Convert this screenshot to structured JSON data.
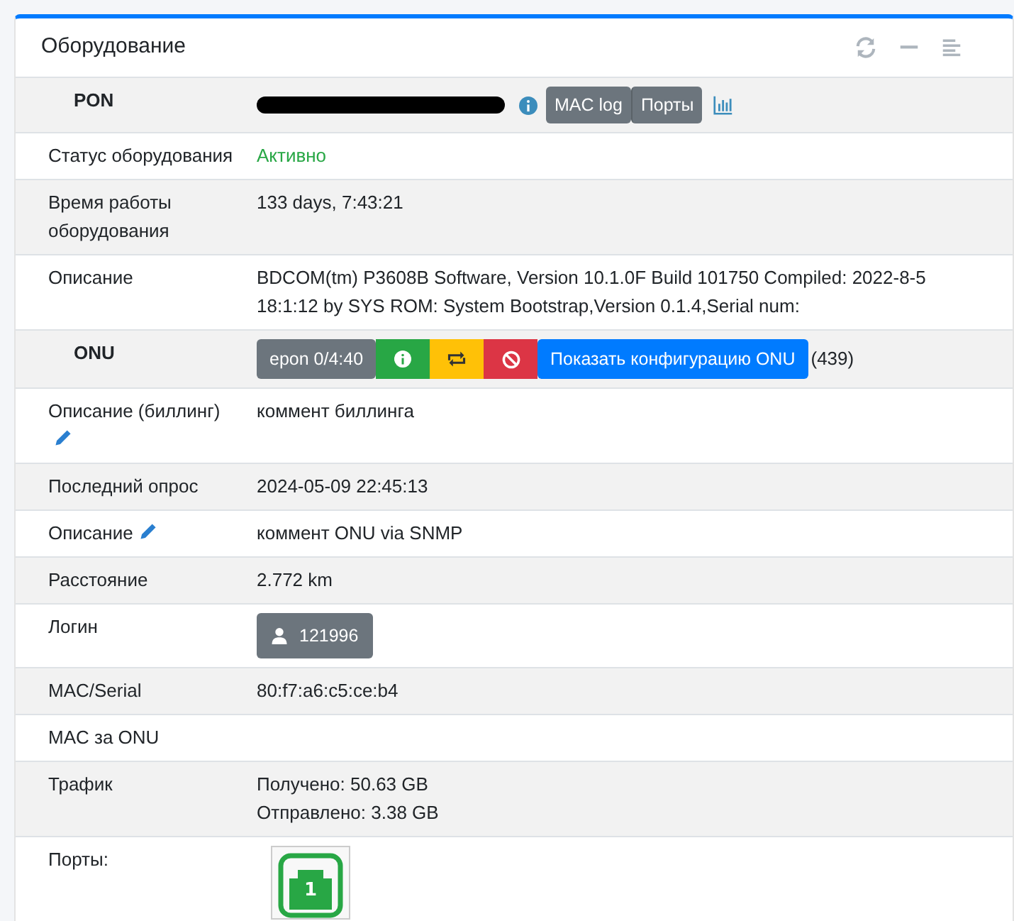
{
  "card": {
    "title": "Оборудование"
  },
  "rows": [
    {
      "kind": "pon",
      "label": "PON",
      "buttons": [
        "MAC log",
        "Порты"
      ]
    },
    {
      "kind": "status",
      "label": "Статус оборудования",
      "value": "Активно",
      "active": true
    },
    {
      "kind": "text",
      "label": "Время работы оборудования",
      "lines": [
        "133 days, 7:43:21"
      ]
    },
    {
      "kind": "description",
      "label": "Описание",
      "value": "BDCOM(tm) P3608B Software, Version 10.1.0F Build 101750 Compiled: 2022-8-5 18:1:12 by SYS ROM: System Bootstrap,Version 0.1.4,Serial num:"
    },
    {
      "kind": "onu",
      "label": "ONU",
      "port": "epon 0/4:40",
      "config_button": "Показать конфигурацию ONU",
      "count": "(439)"
    },
    {
      "kind": "text",
      "label": "Описание (биллинг)",
      "editable": true,
      "lines": [
        "коммент биллинга"
      ]
    },
    {
      "kind": "text",
      "label": "Последний опрос",
      "lines": [
        "2024-05-09 22:45:13"
      ]
    },
    {
      "kind": "text",
      "label": "Описание",
      "editable": true,
      "lines": [
        "коммент ONU via SNMP"
      ]
    },
    {
      "kind": "text",
      "label": "Расстояние",
      "lines": [
        "2.772 km"
      ]
    },
    {
      "kind": "login",
      "label": "Логин",
      "value": "121996"
    },
    {
      "kind": "text",
      "label": "MAC/Serial",
      "lines": [
        "80:f7:a6:c5:ce:b4"
      ]
    },
    {
      "kind": "text",
      "label": "MAC за ONU",
      "lines": []
    },
    {
      "kind": "text",
      "label": "Трафик",
      "lines": [
        "Получено: 50.63 GB",
        "Отправлено: 3.38 GB"
      ]
    },
    {
      "kind": "ports",
      "label": "Порты:",
      "ports": [
        {
          "number": "1",
          "color": "#28a745"
        }
      ]
    }
  ]
}
